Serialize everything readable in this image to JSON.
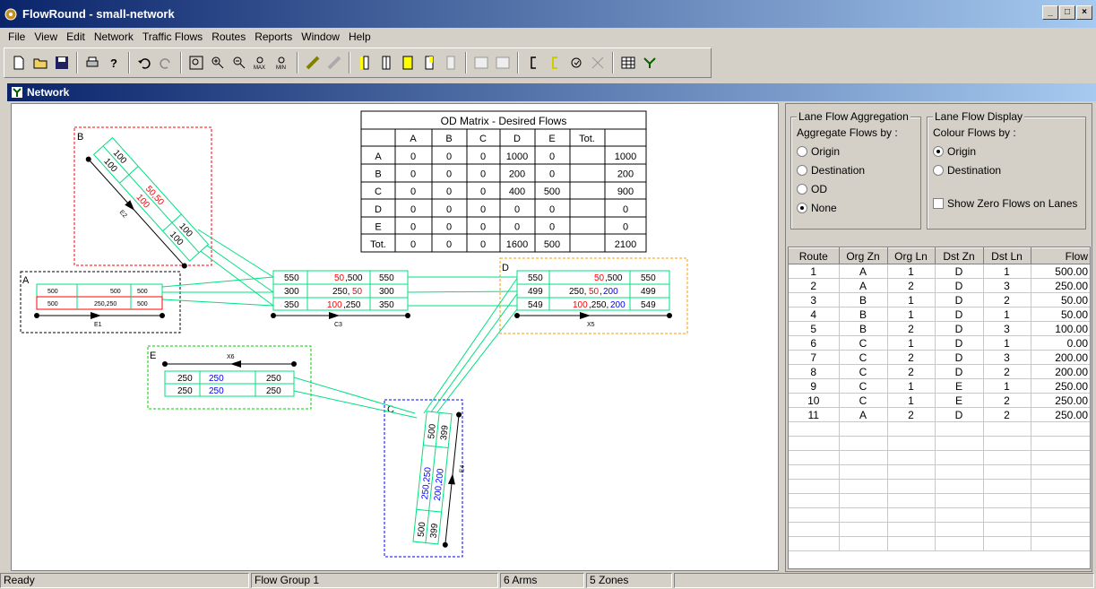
{
  "app": {
    "title": "FlowRound - small-network",
    "window_buttons": [
      "_",
      "□",
      "×"
    ]
  },
  "menu": [
    "File",
    "View",
    "Edit",
    "Network",
    "Traffic Flows",
    "Routes",
    "Reports",
    "Window",
    "Help"
  ],
  "child_window": {
    "title": "Network"
  },
  "od_matrix": {
    "title": "OD Matrix - Desired Flows",
    "headers": [
      "",
      "A",
      "B",
      "C",
      "D",
      "E",
      "Tot."
    ],
    "rows": [
      [
        "A",
        "0",
        "0",
        "0",
        "1000",
        "0",
        "1000"
      ],
      [
        "B",
        "0",
        "0",
        "0",
        "200",
        "0",
        "200"
      ],
      [
        "C",
        "0",
        "0",
        "0",
        "400",
        "500",
        "900"
      ],
      [
        "D",
        "0",
        "0",
        "0",
        "0",
        "0",
        "0"
      ],
      [
        "E",
        "0",
        "0",
        "0",
        "0",
        "0",
        "0"
      ],
      [
        "Tot.",
        "0",
        "0",
        "0",
        "1600",
        "500",
        "2100"
      ]
    ]
  },
  "network": {
    "zones": [
      "A",
      "B",
      "C",
      "D",
      "E"
    ],
    "arms": [
      "E1",
      "E2",
      "C3",
      "E4",
      "X5",
      "X6"
    ],
    "zone_a": {
      "rows": [
        [
          "500",
          "500",
          "500"
        ],
        [
          "500",
          "250,250",
          "500"
        ]
      ]
    },
    "arm_c3": {
      "rows": [
        [
          "550",
          "50",
          ",500",
          "550"
        ],
        [
          "300",
          "250,",
          "50",
          "300"
        ],
        [
          "350",
          "100",
          ",250",
          "350"
        ]
      ]
    },
    "zone_d": {
      "rows": [
        [
          "550",
          "50",
          ",500",
          "550"
        ],
        [
          "499",
          "250,",
          "50",
          ",",
          "200",
          "499"
        ],
        [
          "549",
          "100",
          ",250,",
          "200",
          "549"
        ]
      ]
    },
    "zone_e": {
      "rows": [
        [
          "250",
          "250",
          "250"
        ],
        [
          "250",
          "250",
          "250"
        ]
      ]
    },
    "zone_b": {
      "labels": [
        "100",
        "100",
        "50,50",
        "100",
        "100",
        "100"
      ]
    },
    "zone_c": {
      "labels": [
        "500",
        "399",
        "250,250",
        "200,200",
        "500",
        "399"
      ]
    }
  },
  "panel": {
    "aggregation": {
      "title": "Lane Flow Aggregation",
      "subtitle": "Aggregate Flows by :",
      "options": [
        "Origin",
        "Destination",
        "OD",
        "None"
      ],
      "selected": "None"
    },
    "display": {
      "title": "Lane Flow Display",
      "subtitle": "Colour Flows by :",
      "options": [
        "Origin",
        "Destination"
      ],
      "selected": "Origin",
      "checkbox_label": "Show Zero Flows on Lanes"
    }
  },
  "routes": {
    "headers": [
      "Route",
      "Org Zn",
      "Org Ln",
      "Dst Zn",
      "Dst Ln",
      "Flow"
    ],
    "rows": [
      [
        "1",
        "A",
        "1",
        "D",
        "1",
        "500.00"
      ],
      [
        "2",
        "A",
        "2",
        "D",
        "3",
        "250.00"
      ],
      [
        "3",
        "B",
        "1",
        "D",
        "2",
        "50.00"
      ],
      [
        "4",
        "B",
        "1",
        "D",
        "1",
        "50.00"
      ],
      [
        "5",
        "B",
        "2",
        "D",
        "3",
        "100.00"
      ],
      [
        "6",
        "C",
        "1",
        "D",
        "1",
        "0.00"
      ],
      [
        "7",
        "C",
        "2",
        "D",
        "3",
        "200.00"
      ],
      [
        "8",
        "C",
        "2",
        "D",
        "2",
        "200.00"
      ],
      [
        "9",
        "C",
        "1",
        "E",
        "1",
        "250.00"
      ],
      [
        "10",
        "C",
        "1",
        "E",
        "2",
        "250.00"
      ],
      [
        "11",
        "A",
        "2",
        "D",
        "2",
        "250.00"
      ]
    ]
  },
  "status": {
    "ready": "Ready",
    "flow_group": "Flow Group 1",
    "arms": "6 Arms",
    "zones": "5 Zones"
  },
  "colors": {
    "lane_green": "#00e080",
    "flow_red": "#ff0000",
    "flow_blue": "#0000ff",
    "zone_a": "#000000",
    "zone_b": "#ff0000",
    "zone_c": "#0000ff",
    "zone_d": "#ff9900",
    "zone_e": "#00cc00",
    "title_blue": "#0a246a"
  }
}
